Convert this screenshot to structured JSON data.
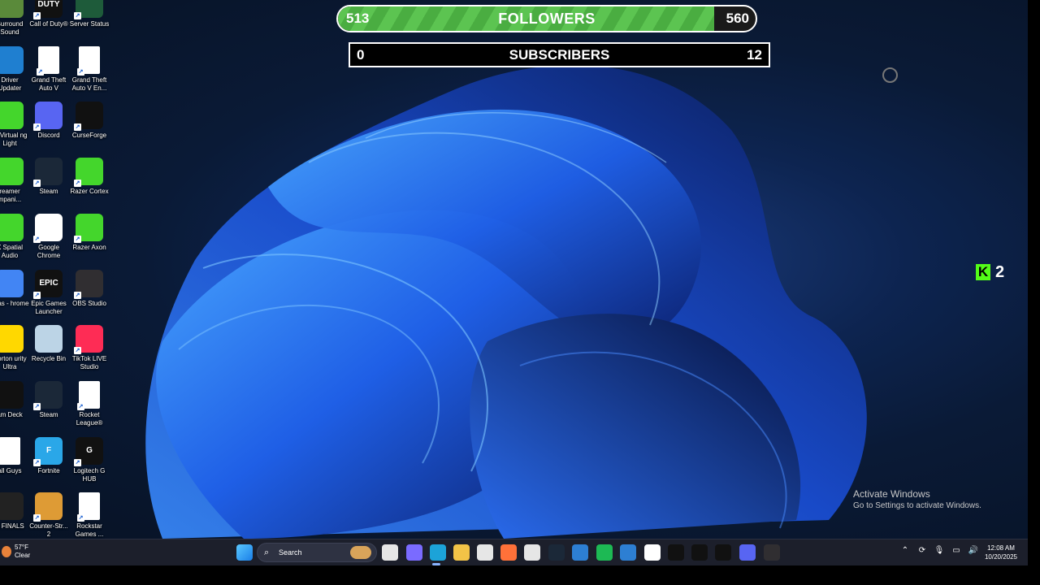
{
  "desktop_icons": [
    {
      "label": "Surround Sound",
      "icon": "surround-sound-icon",
      "color": "#5a8a3a"
    },
    {
      "label": "Call of Duty®",
      "icon": "call-of-duty-icon",
      "color": "#111111",
      "text": "DUTY"
    },
    {
      "label": "Server Status",
      "icon": "server-status-icon",
      "color": "#1e5b3a"
    },
    {
      "label": "Driver Updater",
      "icon": "driver-updater-icon",
      "color": "#1f7fd0"
    },
    {
      "label": "Grand Theft Auto V",
      "icon": "file-icon",
      "color": "#ffffff"
    },
    {
      "label": "Grand Theft Auto V En...",
      "icon": "file-icon",
      "color": "#ffffff"
    },
    {
      "label": "er Virtual ng Light",
      "icon": "razer-virtual-lighting-icon",
      "color": "#44d62c"
    },
    {
      "label": "Discord",
      "icon": "discord-icon",
      "color": "#5865f2"
    },
    {
      "label": "CurseForge",
      "icon": "curseforge-icon",
      "color": "#111111"
    },
    {
      "label": "reamer mpani...",
      "icon": "streamer-companion-icon",
      "color": "#44d62c"
    },
    {
      "label": "Steam",
      "icon": "steam-icon",
      "color": "#1b2838"
    },
    {
      "label": "Razer Cortex",
      "icon": "razer-cortex-icon",
      "color": "#44d62c"
    },
    {
      "label": "X Spatial Audio",
      "icon": "thx-spatial-audio-icon",
      "color": "#44d62c"
    },
    {
      "label": "Google Chrome",
      "icon": "chrome-icon",
      "color": "#ffffff"
    },
    {
      "label": "Razer Axon",
      "icon": "razer-axon-icon",
      "color": "#44d62c"
    },
    {
      "label": "Elias - hrome",
      "icon": "chrome-profile-icon",
      "color": "#4285f4"
    },
    {
      "label": "Epic Games Launcher",
      "icon": "epic-games-icon",
      "color": "#111111",
      "text": "EPIC"
    },
    {
      "label": "OBS Studio",
      "icon": "obs-studio-icon",
      "color": "#302e31"
    },
    {
      "label": "Norton urity Ultra",
      "icon": "norton-icon",
      "color": "#ffd800"
    },
    {
      "label": "Recycle Bin",
      "icon": "recycle-bin-icon",
      "color": "#bcd4e6"
    },
    {
      "label": "TikTok LIVE Studio",
      "icon": "tiktok-live-studio-icon",
      "color": "#fe2c55"
    },
    {
      "label": "am Deck",
      "icon": "stream-deck-icon",
      "color": "#111111"
    },
    {
      "label": "Steam",
      "icon": "steam-icon",
      "color": "#1b2838"
    },
    {
      "label": "Rocket League®",
      "icon": "file-icon",
      "color": "#ffffff"
    },
    {
      "label": "all Guys",
      "icon": "file-icon",
      "color": "#ffffff"
    },
    {
      "label": "Fortnite",
      "icon": "fortnite-icon",
      "color": "#2aa7e8",
      "text": "F"
    },
    {
      "label": "Logitech G HUB",
      "icon": "logitech-g-hub-icon",
      "color": "#111111",
      "text": "G"
    },
    {
      "label": "E FINALS",
      "icon": "the-finals-icon",
      "color": "#222222"
    },
    {
      "label": "Counter-Str... 2",
      "icon": "counter-strike-icon",
      "color": "#de9b35"
    },
    {
      "label": "Rockstar Games ...",
      "icon": "file-icon",
      "color": "#ffffff"
    }
  ],
  "followers_goal": {
    "label": "FOLLOWERS",
    "start": "513",
    "end": "560",
    "progress": 0.9
  },
  "subscribers_goal": {
    "label": "SUBSCRIBERS",
    "start": "0",
    "end": "12"
  },
  "kick_viewers": {
    "count": "2",
    "icon": "kick-icon"
  },
  "activate_windows": {
    "title": "Activate Windows",
    "subtitle": "Go to Settings to activate Windows."
  },
  "taskbar": {
    "weather": {
      "temp": "57°F",
      "condition": "Clear"
    },
    "search_placeholder": "Search",
    "apps": [
      {
        "icon": "windows-start-icon",
        "color": "#3a9bff"
      },
      {
        "icon": "task-view-icon",
        "color": "#e6e6e6"
      },
      {
        "icon": "copilot-icon",
        "color": "#7a6bff"
      },
      {
        "icon": "edge-icon",
        "color": "#1ca3d8"
      },
      {
        "icon": "file-explorer-icon",
        "color": "#f2c347"
      },
      {
        "icon": "microsoft-store-icon",
        "color": "#e6e6e6"
      },
      {
        "icon": "firefox-icon",
        "color": "#ff7139"
      },
      {
        "icon": "news-icon",
        "color": "#e6e6e6"
      },
      {
        "icon": "steam-icon",
        "color": "#1b2838"
      },
      {
        "icon": "app-icon",
        "color": "#2d7fd3"
      },
      {
        "icon": "spotify-icon",
        "color": "#1db954"
      },
      {
        "icon": "app-window-icon",
        "color": "#2d7fd3"
      },
      {
        "icon": "chrome-icon",
        "color": "#ffffff"
      },
      {
        "icon": "razer-icon",
        "color": "#111111"
      },
      {
        "icon": "epic-games-icon",
        "color": "#111111"
      },
      {
        "icon": "tiktok-icon",
        "color": "#111111"
      },
      {
        "icon": "discord-icon",
        "color": "#5865f2"
      },
      {
        "icon": "obs-studio-icon",
        "color": "#302e31"
      }
    ],
    "tray": [
      {
        "icon": "chevron-up-icon",
        "glyph": "⌃"
      },
      {
        "icon": "sync-icon",
        "glyph": "⟳"
      },
      {
        "icon": "microphone-icon",
        "glyph": "🎙"
      },
      {
        "icon": "network-icon",
        "glyph": "▭"
      },
      {
        "icon": "volume-icon",
        "glyph": "🔊"
      }
    ],
    "time": "12:08 AM",
    "date": "10/20/2025"
  }
}
